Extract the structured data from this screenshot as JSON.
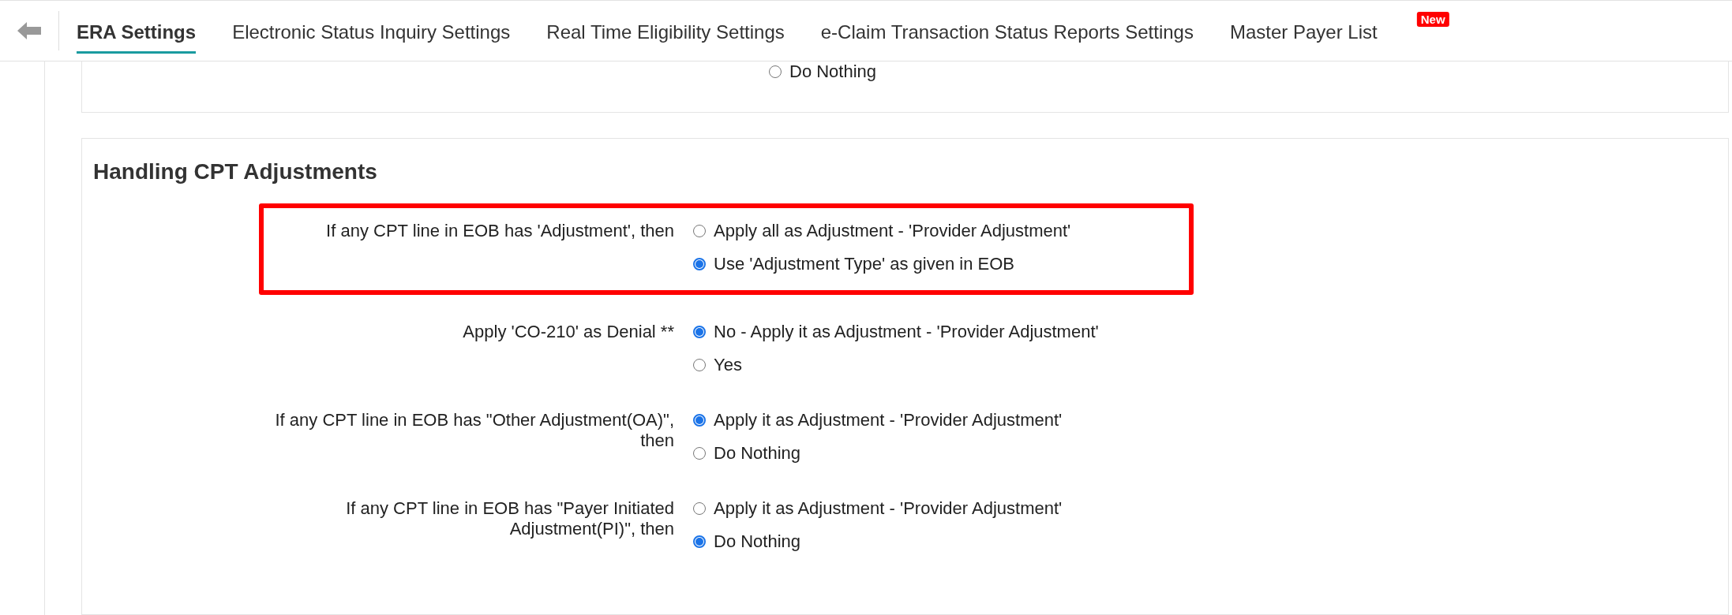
{
  "tabs": [
    {
      "label": "ERA Settings",
      "selected": true
    },
    {
      "label": "Electronic Status Inquiry Settings",
      "selected": false
    },
    {
      "label": "Real Time Eligibility Settings",
      "selected": false
    },
    {
      "label": "e-Claim Transaction Status Reports Settings",
      "selected": false
    },
    {
      "label": "Master Payer List",
      "selected": false,
      "badge": "New"
    }
  ],
  "previous_section": {
    "options": [
      {
        "label": "Do Nothing",
        "selected": false
      }
    ]
  },
  "section": {
    "title": "Handling CPT Adjustments",
    "settings": [
      {
        "label": "If any CPT line in EOB has 'Adjustment', then",
        "highlighted": true,
        "options": [
          {
            "label": "Apply all as Adjustment - 'Provider Adjustment'",
            "selected": false
          },
          {
            "label": "Use 'Adjustment Type' as given in EOB",
            "selected": true
          }
        ]
      },
      {
        "label": "Apply 'CO-210' as Denial **",
        "highlighted": false,
        "options": [
          {
            "label": "No - Apply it as Adjustment - 'Provider Adjustment'",
            "selected": true
          },
          {
            "label": "Yes",
            "selected": false
          }
        ]
      },
      {
        "label": "If any CPT line in EOB has \"Other Adjustment(OA)\", then",
        "highlighted": false,
        "options": [
          {
            "label": "Apply it as Adjustment - 'Provider Adjustment'",
            "selected": true
          },
          {
            "label": "Do Nothing",
            "selected": false
          }
        ]
      },
      {
        "label": "If any CPT line in EOB has \"Payer Initiated Adjustment(PI)\", then",
        "highlighted": false,
        "options": [
          {
            "label": "Apply it as Adjustment - 'Provider Adjustment'",
            "selected": false
          },
          {
            "label": "Do Nothing",
            "selected": true
          }
        ]
      }
    ]
  }
}
